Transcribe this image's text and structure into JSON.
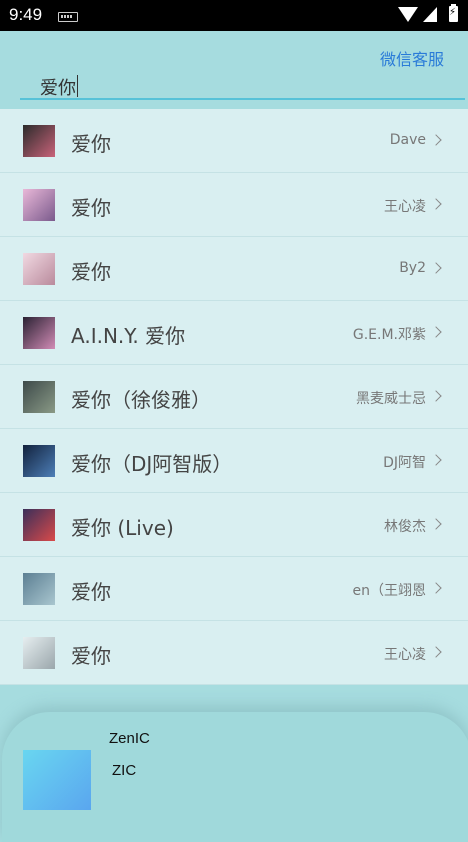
{
  "status": {
    "time": "9:49"
  },
  "header": {
    "service_label": "微信客服"
  },
  "search": {
    "value": "爱你"
  },
  "results": [
    {
      "title": "爱你",
      "artist": "Dave",
      "cover": [
        "#2b2b2b",
        "#c9637a"
      ]
    },
    {
      "title": "爱你",
      "artist": "王心凌",
      "cover": [
        "#e9b8d8",
        "#7a5a8c"
      ]
    },
    {
      "title": "爱你",
      "artist": "By2",
      "cover": [
        "#f1d9e2",
        "#b98a9c"
      ]
    },
    {
      "title": "A.I.N.Y. 爱你",
      "artist": "G.E.M.邓紫",
      "cover": [
        "#2a2233",
        "#d28cb6"
      ]
    },
    {
      "title": "爱你（徐俊雅）",
      "artist": "黑麦威士忌",
      "cover": [
        "#3d4a4a",
        "#8a9a86"
      ]
    },
    {
      "title": "爱你（DJ阿智版）",
      "artist": "DJ阿智",
      "cover": [
        "#12223d",
        "#4d7fb8"
      ]
    },
    {
      "title": "爱你 (Live)",
      "artist": "林俊杰",
      "cover": [
        "#3a2f5a",
        "#d94a4a"
      ]
    },
    {
      "title": "爱你",
      "artist": "en（王翊恩",
      "cover": [
        "#5c7f93",
        "#a9c6cf"
      ]
    },
    {
      "title": "爱你",
      "artist": "王心凌",
      "cover": [
        "#e6eef0",
        "#9aa6ab"
      ]
    }
  ],
  "player": {
    "title": "ZenIC",
    "artist": "ZIC"
  },
  "colors": {
    "background": "#a6dcdf",
    "list": "#d9eff1",
    "accent": "#2a7bd8",
    "underline": "#57c2d8"
  }
}
